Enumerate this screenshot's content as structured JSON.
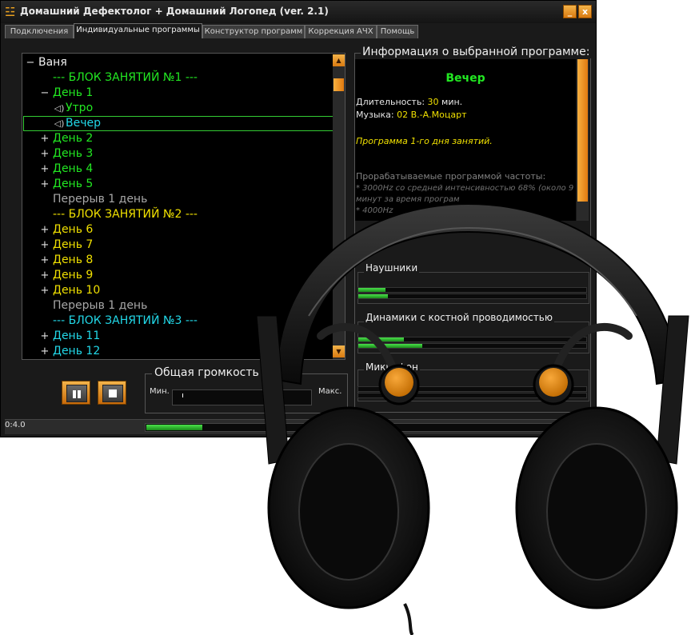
{
  "window": {
    "title": "Домашний Дефектолог + Домашний Логопед  (ver. 2.1)",
    "minimize_label": "_",
    "close_label": "x"
  },
  "tabs": [
    {
      "label": "Подключения"
    },
    {
      "label": "Индивидуальные программы"
    },
    {
      "label": "Конструктор программ"
    },
    {
      "label": "Коррекция АЧХ"
    },
    {
      "label": "Помощь"
    }
  ],
  "tree": {
    "rows": [
      {
        "expander": "—",
        "text": "Ваня",
        "color": "white"
      },
      {
        "text": "--- БЛОК ЗАНЯТИЙ №1 ---",
        "color": "green"
      },
      {
        "expander": "—",
        "text": "День 1",
        "color": "green"
      },
      {
        "speaker": true,
        "text": "Утро",
        "color": "green"
      },
      {
        "speaker": true,
        "text": "Вечер",
        "color": "cyan",
        "selected": true
      },
      {
        "expander": "+",
        "text": "День 2",
        "color": "green"
      },
      {
        "expander": "+",
        "text": "День 3",
        "color": "green"
      },
      {
        "expander": "+",
        "text": "День 4",
        "color": "green"
      },
      {
        "expander": "+",
        "text": "День 5",
        "color": "green"
      },
      {
        "text": "Перерыв 1 день",
        "color": "gray"
      },
      {
        "text": "--- БЛОК ЗАНЯТИЙ №2 ---",
        "color": "yellow"
      },
      {
        "expander": "+",
        "text": "День 6",
        "color": "yellow"
      },
      {
        "expander": "+",
        "text": "День 7",
        "color": "yellow"
      },
      {
        "expander": "+",
        "text": "День 8",
        "color": "yellow"
      },
      {
        "expander": "+",
        "text": "День 9",
        "color": "yellow"
      },
      {
        "expander": "+",
        "text": "День 10",
        "color": "yellow"
      },
      {
        "text": "Перерыв 1 день",
        "color": "gray"
      },
      {
        "text": "--- БЛОК ЗАНЯТИЙ №3 ---",
        "color": "cyan"
      },
      {
        "expander": "+",
        "text": "День 11",
        "color": "cyan"
      },
      {
        "expander": "+",
        "text": "День 12",
        "color": "cyan"
      }
    ]
  },
  "controls": {
    "volume_title": "Общая громкость",
    "min_label": "Мин.",
    "max_label": "Макс."
  },
  "status": {
    "time": "0:4.0",
    "progress_fraction": 0.13
  },
  "info": {
    "title": "Информация о выбранной программе:",
    "program_name": "Вечер",
    "duration_label": "Длительность:",
    "duration_value": "30",
    "duration_unit": "мин.",
    "music_label": "Музыка:",
    "music_value": "02 В.-А.Моцарт",
    "description": "Программа 1-го дня занятий.",
    "freq_title": "Прорабатываемые программой частоты:",
    "freq_items": [
      "* 3000Hz со средней интенсивностью 68% (около 9",
      "минут за время програм",
      "* 4000Hz"
    ]
  },
  "levels": {
    "headphones_label": "Наушники",
    "bone_label": "Динамики с костной проводимостью",
    "mic_label": "Микрофон",
    "headphones": [
      0.12,
      0.13
    ],
    "bone": [
      0.2,
      0.28
    ],
    "mic": [
      0.0,
      0.0
    ]
  },
  "colors": {
    "accent": "#e8901a",
    "green": "#22e822",
    "yellow": "#f0e000",
    "cyan": "#22d8e8",
    "gray": "#a8a8a8"
  }
}
